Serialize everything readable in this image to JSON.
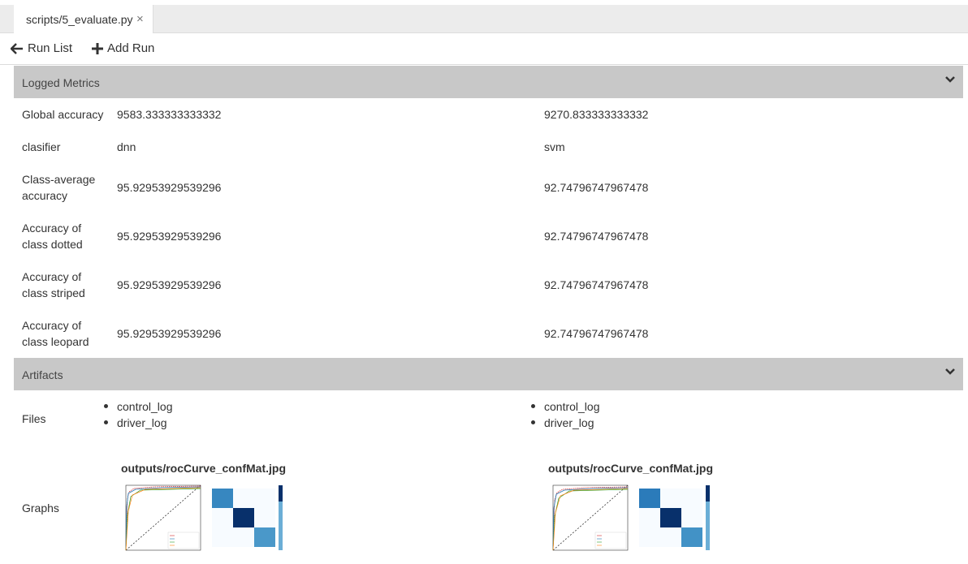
{
  "tab": {
    "title": "scripts/5_evaluate.py",
    "close": "×"
  },
  "toolbar": {
    "run_list": "Run List",
    "add_run": "Add Run"
  },
  "metrics": {
    "header": "Logged Metrics",
    "rows": [
      {
        "label": "Global accuracy",
        "values": [
          "9583.333333333332",
          "9270.833333333332"
        ]
      },
      {
        "label": "clasifier",
        "values": [
          "dnn",
          "svm"
        ]
      },
      {
        "label": "Class-average accuracy",
        "values": [
          "95.92953929539296",
          "92.74796747967478"
        ]
      },
      {
        "label": "Accuracy of class dotted",
        "values": [
          "95.92953929539296",
          "92.74796747967478"
        ]
      },
      {
        "label": "Accuracy of class striped",
        "values": [
          "95.92953929539296",
          "92.74796747967478"
        ]
      },
      {
        "label": "Accuracy of class leopard",
        "values": [
          "95.92953929539296",
          "92.74796747967478"
        ]
      }
    ]
  },
  "artifacts": {
    "header": "Artifacts",
    "files_label": "Files",
    "files": [
      [
        "control_log",
        "driver_log"
      ],
      [
        "control_log",
        "driver_log"
      ]
    ],
    "graphs_label": "Graphs",
    "graphs": [
      "outputs/rocCurve_confMat.jpg",
      "outputs/rocCurve_confMat.jpg"
    ]
  },
  "colors": {
    "section_header": "#c8c8c8",
    "tab_bar": "#ececec",
    "heat_dark": "#08306b",
    "heat_mid": "#3787c0",
    "heat_light": "#f7fbff"
  }
}
